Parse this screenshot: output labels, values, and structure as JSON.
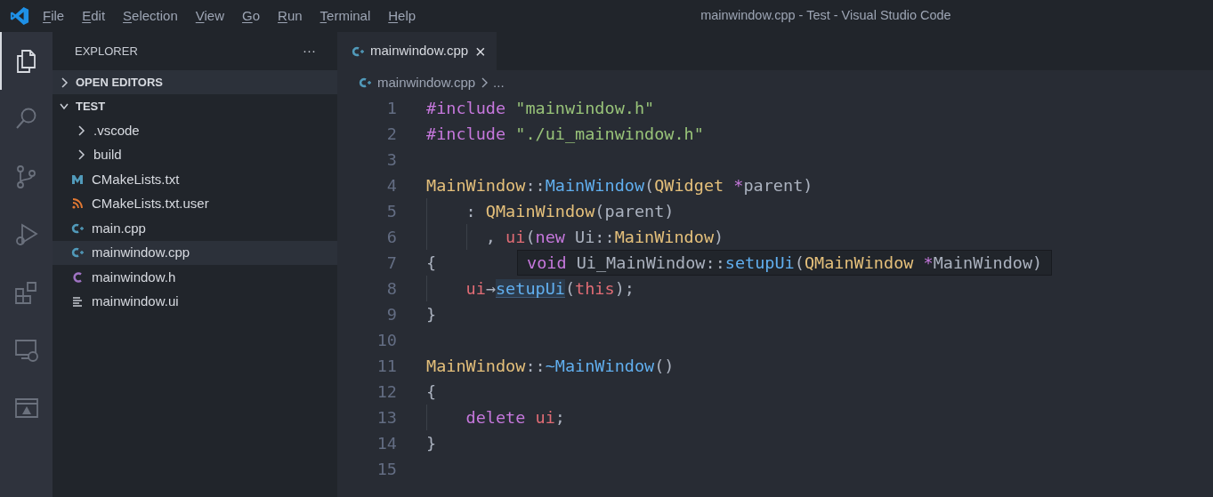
{
  "window": {
    "title": "mainwindow.cpp - Test - Visual Studio Code"
  },
  "menu": [
    "File",
    "Edit",
    "Selection",
    "View",
    "Go",
    "Run",
    "Terminal",
    "Help"
  ],
  "activity_bar": [
    {
      "kind": "explorer",
      "selected": true
    },
    {
      "kind": "search",
      "selected": false
    },
    {
      "kind": "source-control",
      "selected": false
    },
    {
      "kind": "run",
      "selected": false
    },
    {
      "kind": "extensions",
      "selected": false
    },
    {
      "kind": "remote",
      "selected": false
    },
    {
      "kind": "panel",
      "selected": false
    }
  ],
  "sidebar": {
    "title": "EXPLORER",
    "more": "···",
    "sections": [
      {
        "label": "OPEN EDITORS",
        "expanded": false
      },
      {
        "label": "TEST",
        "expanded": true
      }
    ],
    "items": [
      {
        "kind": "folder",
        "label": ".vscode",
        "selected": false
      },
      {
        "kind": "folder",
        "label": "build",
        "selected": false
      },
      {
        "kind": "cmake",
        "label": "CMakeLists.txt",
        "selected": false
      },
      {
        "kind": "rss",
        "label": "CMakeLists.txt.user",
        "selected": false
      },
      {
        "kind": "cpp",
        "label": "main.cpp",
        "selected": false
      },
      {
        "kind": "cpp",
        "label": "mainwindow.cpp",
        "selected": true
      },
      {
        "kind": "c",
        "label": "mainwindow.h",
        "selected": false
      },
      {
        "kind": "text",
        "label": "mainwindow.ui",
        "selected": false
      }
    ]
  },
  "tabs": [
    {
      "label": "mainwindow.cpp",
      "selected": true,
      "close": "×"
    }
  ],
  "breadcrumb": {
    "file": "mainwindow.cpp",
    "rest": "..."
  },
  "code": [
    {
      "number": "1",
      "tokens": [
        {
          "t": "#include",
          "kind": "keyword"
        },
        {
          "t": " \"mainwindow.h\"",
          "kind": "string"
        }
      ]
    },
    {
      "number": "2",
      "tokens": [
        {
          "t": "#include",
          "kind": "keyword"
        },
        {
          "t": " \"./ui_mainwindow.h\"",
          "kind": "string"
        }
      ]
    },
    {
      "number": "3"
    },
    {
      "number": "4",
      "tokens": [
        {
          "t": "MainWindow",
          "kind": "type"
        },
        {
          "t": "::",
          "kind": "plain"
        },
        {
          "t": "MainWindow",
          "kind": "function"
        },
        {
          "t": "(",
          "kind": "plain"
        },
        {
          "t": "QWidget",
          "kind": "type"
        },
        {
          "t": " *",
          "kind": "keyword"
        },
        {
          "t": "parent)",
          "kind": "plain"
        }
      ]
    },
    {
      "number": "5",
      "tokens": [
        {
          "t": "    : ",
          "kind": "plain"
        },
        {
          "t": "QMainWindow",
          "kind": "type"
        },
        {
          "t": "(parent)",
          "kind": "plain"
        }
      ]
    },
    {
      "number": "6",
      "tokens": [
        {
          "t": "      , ",
          "kind": "plain"
        },
        {
          "t": "ui",
          "kind": "variable"
        },
        {
          "t": "(",
          "kind": "plain"
        },
        {
          "t": "new",
          "kind": "keyword"
        },
        {
          "t": " Ui::",
          "kind": "plain"
        },
        {
          "t": "MainWindow",
          "kind": "type"
        },
        {
          "t": ")",
          "kind": "plain"
        }
      ]
    },
    {
      "number": "7",
      "tokens": [
        {
          "t": "{",
          "kind": "plain"
        }
      ]
    },
    {
      "number": "8",
      "tokens": [
        {
          "t": "    ui",
          "kind": "variable"
        },
        {
          "t": "→",
          "kind": "plain"
        },
        {
          "t": "setupUi",
          "kind": "function",
          "highlighted": true
        },
        {
          "t": "(",
          "kind": "plain"
        },
        {
          "t": "this",
          "kind": "variable"
        },
        {
          "t": ");",
          "kind": "plain"
        }
      ]
    },
    {
      "number": "9",
      "tokens": [
        {
          "t": "}",
          "kind": "plain"
        }
      ]
    },
    {
      "number": "10"
    },
    {
      "number": "11",
      "tokens": [
        {
          "t": "MainWindow",
          "kind": "type"
        },
        {
          "t": "::",
          "kind": "plain"
        },
        {
          "t": "~MainWindow",
          "kind": "function"
        },
        {
          "t": "()",
          "kind": "plain"
        }
      ]
    },
    {
      "number": "12",
      "tokens": [
        {
          "t": "{",
          "kind": "plain"
        }
      ]
    },
    {
      "number": "13",
      "tokens": [
        {
          "t": "    delete",
          "kind": "keyword"
        },
        {
          "t": " ui",
          "kind": "variable"
        },
        {
          "t": ";",
          "kind": "plain"
        }
      ]
    },
    {
      "number": "14",
      "tokens": [
        {
          "t": "}",
          "kind": "plain"
        }
      ]
    },
    {
      "number": "15"
    }
  ],
  "hover": {
    "tokens": [
      {
        "t": "void",
        "kind": "keyword"
      },
      {
        "t": " Ui_MainWindow::",
        "kind": "plain"
      },
      {
        "t": "setupUi",
        "kind": "function"
      },
      {
        "t": "(",
        "kind": "plain"
      },
      {
        "t": "QMainWindow",
        "kind": "type"
      },
      {
        "t": " *",
        "kind": "keyword"
      },
      {
        "t": "MainWindow)",
        "kind": "plain"
      }
    ]
  }
}
